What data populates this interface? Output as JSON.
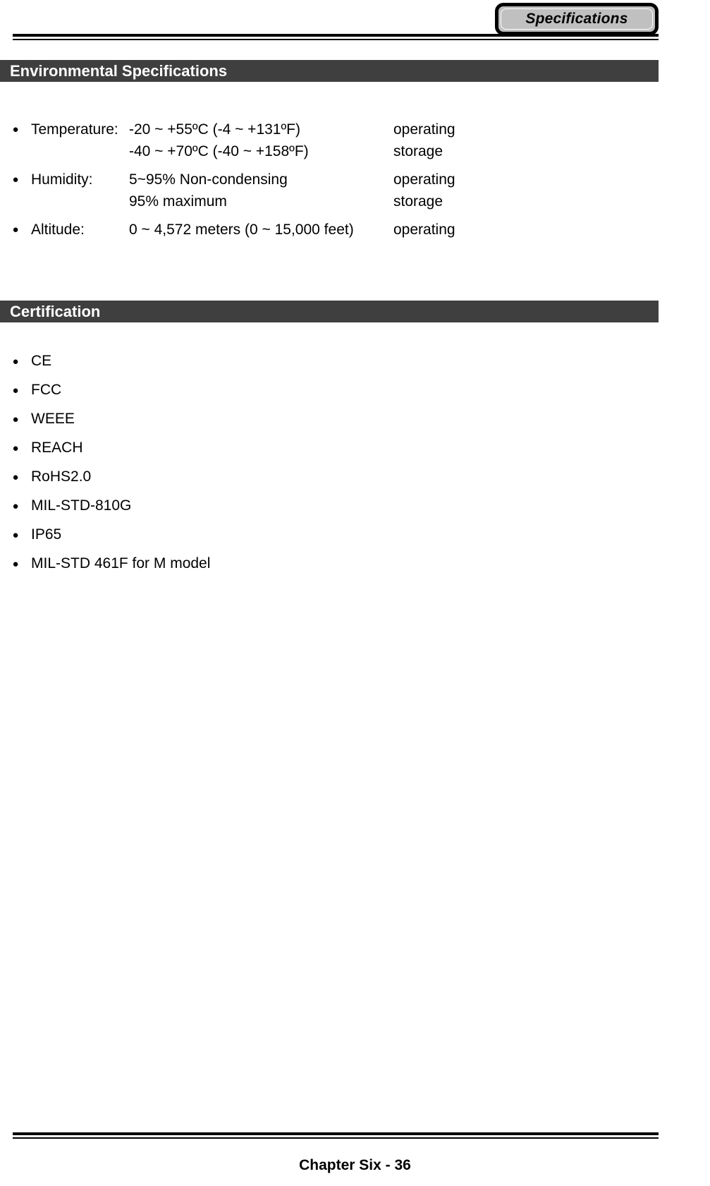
{
  "header": {
    "tab_label": "Specifications"
  },
  "sections": [
    {
      "id": "environmental",
      "title": "Environmental Specifications",
      "rows": [
        {
          "label": "Temperature:",
          "values": [
            "-20 ~ +55ºC (-4 ~ +131ºF)",
            "-40 ~ +70ºC (-40 ~ +158ºF)"
          ],
          "modes": [
            "operating",
            "storage"
          ]
        },
        {
          "label": "Humidity:",
          "values": [
            "5~95% Non-condensing",
            "95% maximum"
          ],
          "modes": [
            "operating",
            "storage"
          ]
        },
        {
          "label": "Altitude:",
          "values": [
            "0 ~ 4,572 meters (0 ~ 15,000 feet)"
          ],
          "modes": [
            "operating"
          ]
        }
      ]
    },
    {
      "id": "certification",
      "title": "Certification",
      "items": [
        "CE",
        "FCC",
        "WEEE",
        "REACH",
        "RoHS2.0",
        "MIL-STD-810G",
        "IP65",
        "MIL-STD 461F for M model"
      ]
    }
  ],
  "footer": {
    "page_label": "Chapter Six - 36"
  },
  "colors": {
    "section_bar_background": "#3f3f3f",
    "section_bar_text": "#ffffff",
    "tab_background": "#c0c0c0",
    "page_background": "#ffffff",
    "text": "#000000"
  }
}
